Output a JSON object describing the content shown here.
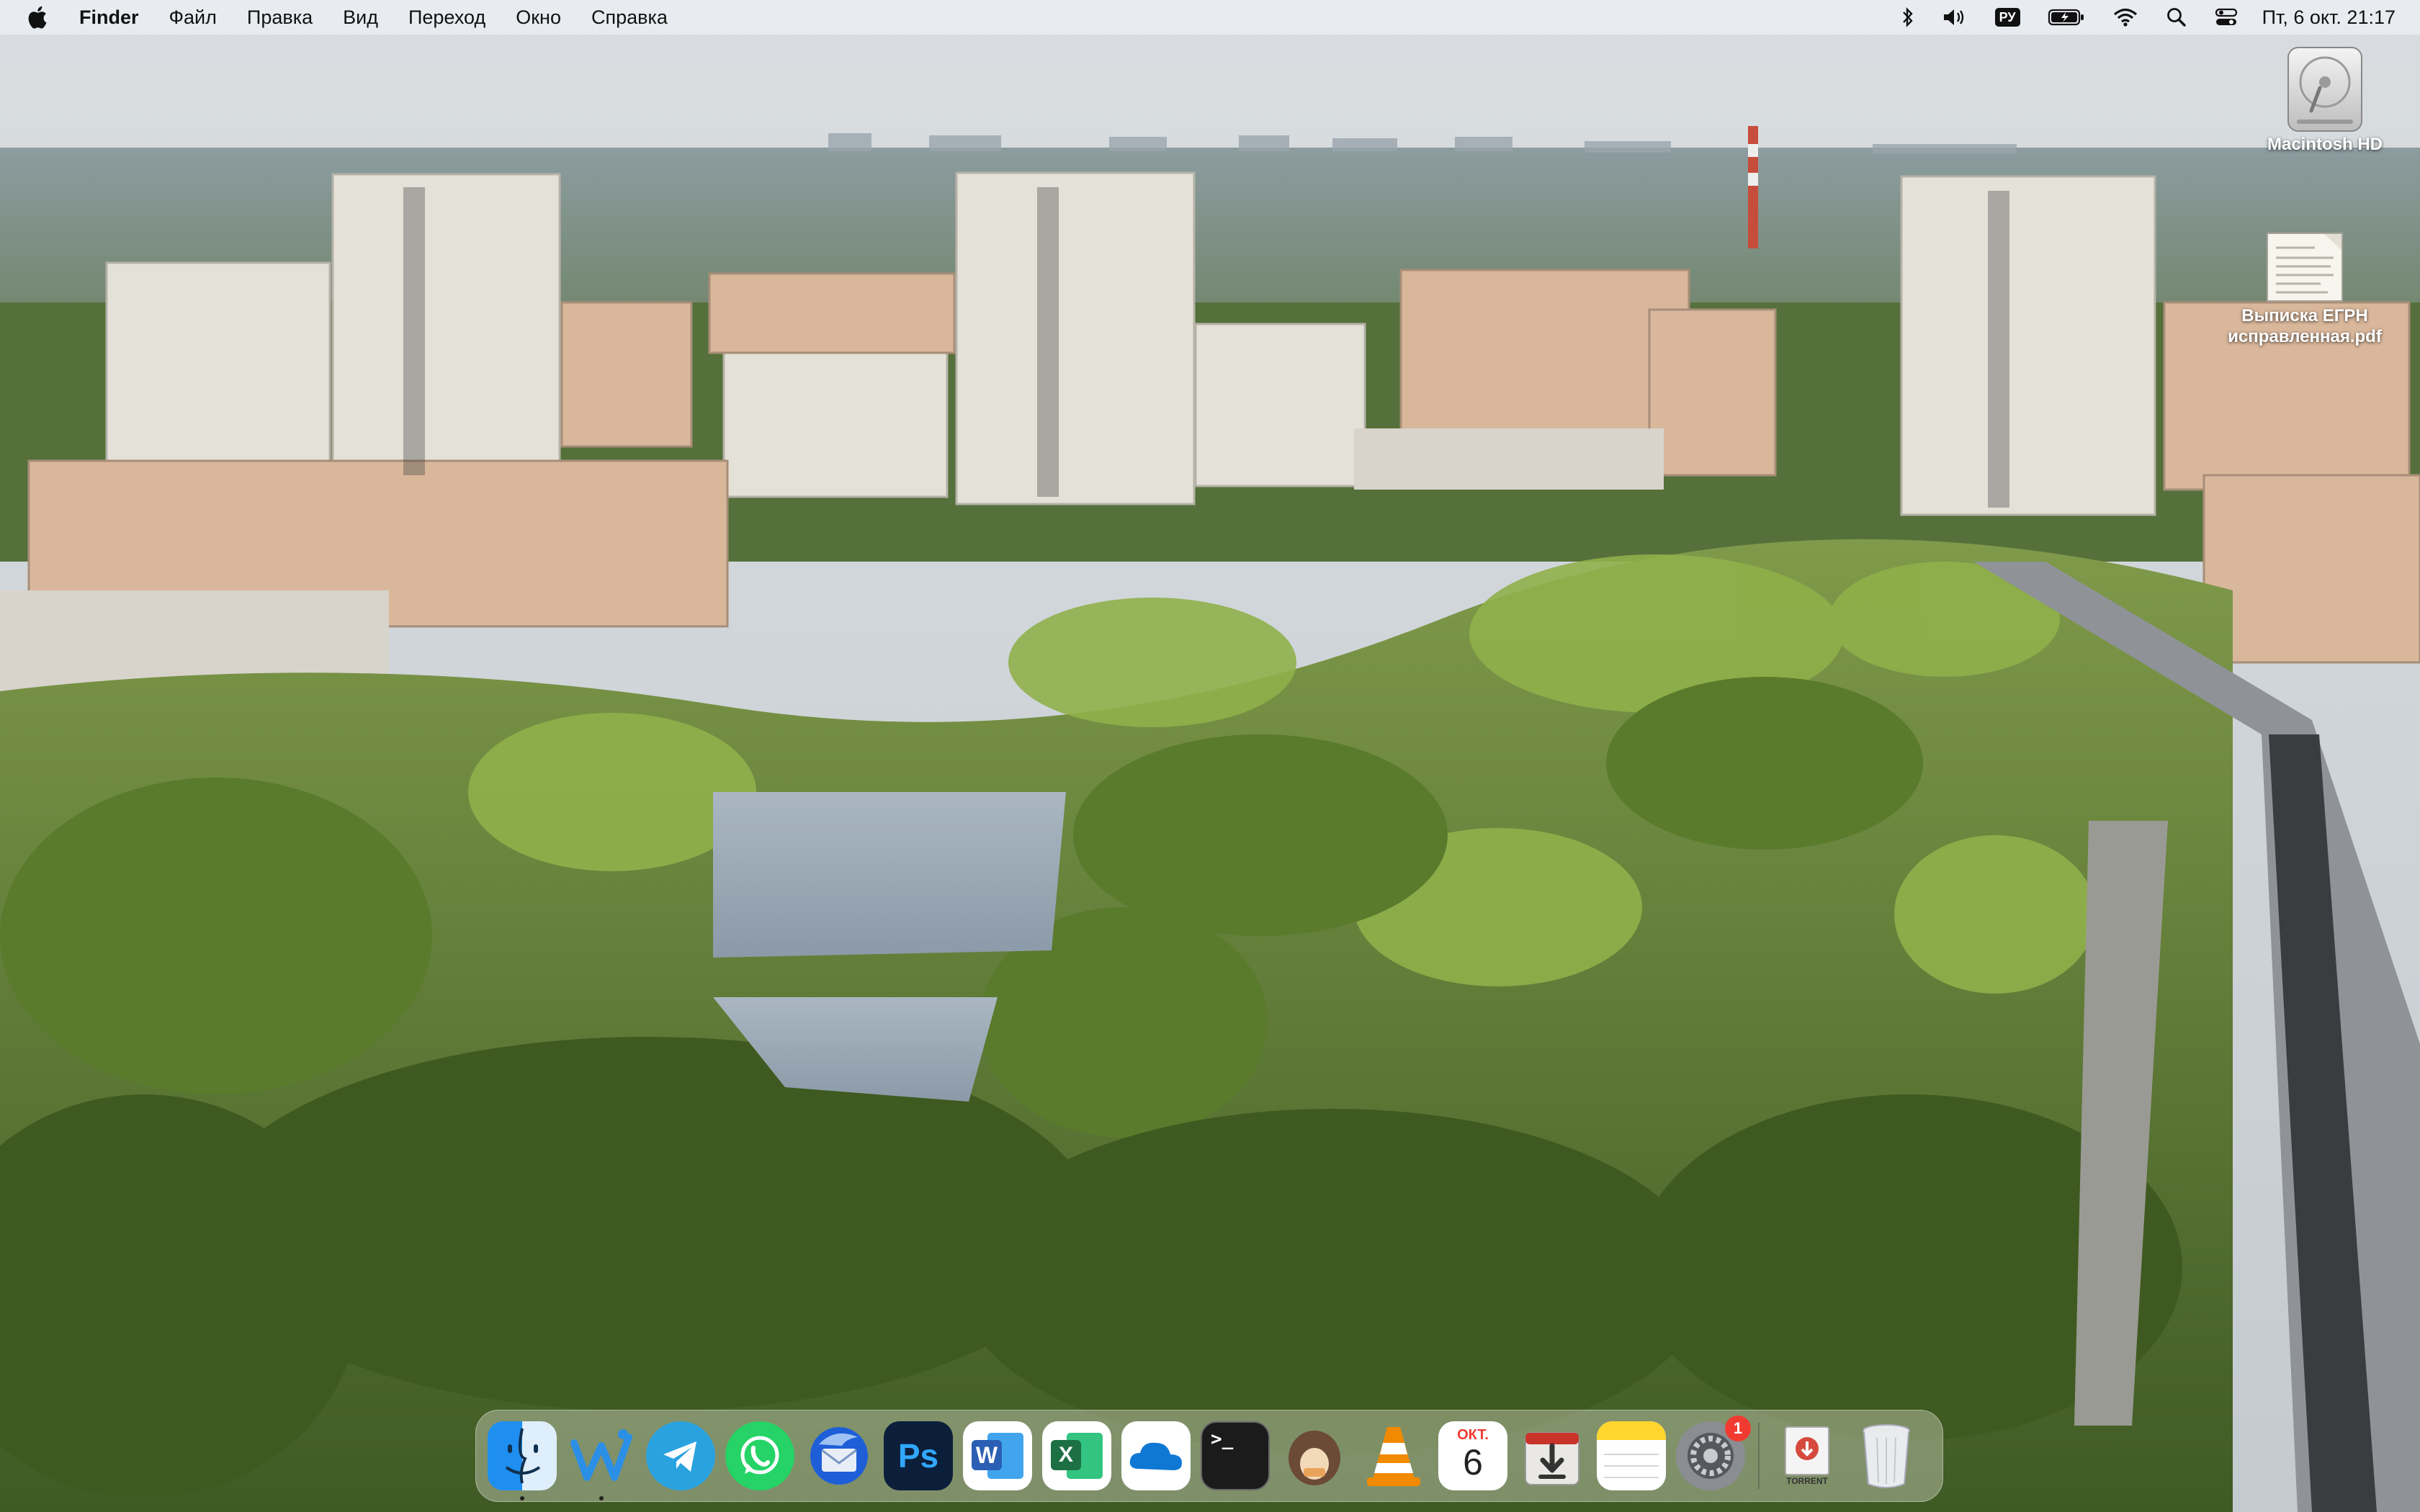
{
  "menubar": {
    "app_name": "Finder",
    "menus": [
      "Файл",
      "Правка",
      "Вид",
      "Переход",
      "Окно",
      "Справка"
    ],
    "status_icons": [
      "bluetooth-icon",
      "volume-icon",
      "input-source-icon",
      "battery-icon",
      "wifi-icon",
      "spotlight-icon",
      "control-center-icon"
    ],
    "input_source": "РУ",
    "clock": "Пт, 6 окт.  21:17"
  },
  "desktop": {
    "icons": [
      {
        "label": "Macintosh HD",
        "icon": "hard-drive-icon"
      },
      {
        "label_line1": "Выписка ЕГРН",
        "label_line2": "исправленная.pdf",
        "icon": "pdf-document-icon"
      }
    ]
  },
  "dock": {
    "apps": [
      {
        "name": "Finder",
        "icon": "finder-icon",
        "running": true
      },
      {
        "name": "Widget app",
        "icon": "wave-w-icon",
        "running": true
      },
      {
        "name": "Telegram",
        "icon": "telegram-icon",
        "running": false
      },
      {
        "name": "WhatsApp",
        "icon": "whatsapp-icon",
        "running": false
      },
      {
        "name": "Thunderbird",
        "icon": "mail-bird-icon",
        "running": false
      },
      {
        "name": "Photoshop",
        "icon": "photoshop-icon",
        "glyph": "Ps",
        "running": false
      },
      {
        "name": "Word",
        "icon": "word-icon",
        "glyph": "W",
        "running": false
      },
      {
        "name": "Excel",
        "icon": "excel-icon",
        "glyph": "X",
        "running": false
      },
      {
        "name": "OneDrive",
        "icon": "onedrive-icon",
        "running": false
      },
      {
        "name": "Terminal",
        "icon": "terminal-icon",
        "glyph": ">_",
        "running": false
      },
      {
        "name": "Keka",
        "icon": "archive-icon",
        "running": false
      },
      {
        "name": "VLC",
        "icon": "vlc-cone-icon",
        "running": false
      },
      {
        "name": "Calendar",
        "icon": "calendar-icon",
        "month": "ОКТ.",
        "day": "6",
        "running": false
      },
      {
        "name": "Downloader",
        "icon": "download-box-icon",
        "running": false
      },
      {
        "name": "Notes",
        "icon": "notes-icon",
        "running": false
      },
      {
        "name": "System Settings",
        "icon": "settings-gear-icon",
        "badge": "1",
        "running": false
      }
    ],
    "stack": {
      "name": "Torrent",
      "label": "TORRENT",
      "icon": "torrent-doc-icon"
    },
    "trash": {
      "name": "Trash",
      "icon": "trash-icon"
    }
  },
  "colors": {
    "menubar_bg": "#eceef2",
    "badge_red": "#f23b30",
    "finder_blue": "#1e8ff0",
    "telegram_blue": "#2aa2e0",
    "whatsapp_green": "#25d366",
    "photoshop_navy": "#0b1f3a",
    "word_blue": "#2b5fb4",
    "excel_green": "#1d7044",
    "onedrive_blue": "#0f78d4"
  }
}
